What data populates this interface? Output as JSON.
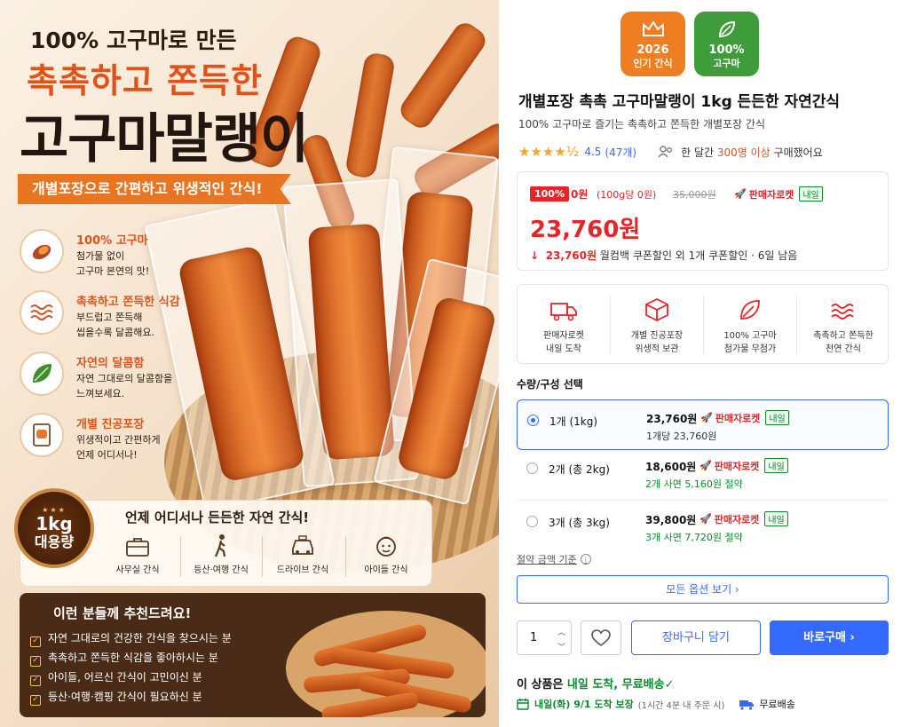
{
  "banner": {
    "headline_small": "100% 고구마로 만든",
    "headline_orange": "촉촉하고 쫀득한",
    "headline_big": "고구마말랭이",
    "ribbon": "개별포장으로 간편하고 위생적인 간식!",
    "features": [
      {
        "icon": "sweet-potato-icon",
        "title": "100% 고구마",
        "desc": "첨가물 없이\n고구마 본연의 맛!"
      },
      {
        "icon": "wave-icon",
        "title": "촉촉하고 쫀득한 식감",
        "desc": "부드럽고 쫀득해\n씹을수록 달콤해요."
      },
      {
        "icon": "leaf-icon",
        "title": "자연의 달콤함",
        "desc": "자연 그대로의 달콤함을\n느껴보세요."
      },
      {
        "icon": "package-icon",
        "title": "개별 진공포장",
        "desc": "위생적이고 간편하게\n언제 어디서나!"
      }
    ],
    "badge": {
      "line1": "1kg",
      "line2": "대용량",
      "stars": "★★★"
    },
    "anytime_title": "언제 어디서나 든든한 자연 간식!",
    "uses": [
      {
        "icon": "briefcase-icon",
        "label": "사무실 간식"
      },
      {
        "icon": "hiker-icon",
        "label": "등산·여행 간식"
      },
      {
        "icon": "car-icon",
        "label": "드라이브 간식"
      },
      {
        "icon": "child-face-icon",
        "label": "아이들 간식"
      }
    ],
    "recommend_title": "이런 분들께 추천드려요!",
    "recommend_items": [
      "자연 그대로의 건강한 간식을 찾으시는 분",
      "촉촉하고 쫀득한 식감을 좋아하시는 분",
      "아이들, 어르신 간식이 고민이신 분",
      "등산·여행·캠핑 간식이 필요하신 분"
    ]
  },
  "product": {
    "badges": [
      {
        "icon": "crown-icon",
        "line1": "2026",
        "line2": "인기 간식",
        "color": "#ef7d22"
      },
      {
        "icon": "leaf-icon",
        "line1": "100%",
        "line2": "고구마",
        "color": "#3f9c3a"
      }
    ],
    "title": "개별포장 촉촉 고구마말랭이 1kg 든든한 자연간식",
    "subtitle": "100% 고구마로 즐기는 촉촉하고 쫀득한 개별포장 간식",
    "stars": "★★★★½",
    "rating": "4.5",
    "review_count": "(47개)",
    "buyers_prefix": "한 달간",
    "buyers_highlight": "300명 이상",
    "buyers_suffix": "구매했어요"
  },
  "price": {
    "discount_tag": "100%",
    "coupon_price": "0원",
    "per_unit": "(100g당 0원)",
    "original_price": "35,000원",
    "rocket_label": "판매자로켓",
    "tomorrow_label": "내일",
    "main_price": "23,760원",
    "coupon_arrow": "↓",
    "coupon_amount": "23,760원",
    "coupon_text": "월컴백 쿠폰할인 외 1개 쿠폰할인 · 6일 남음"
  },
  "benefits": [
    {
      "icon": "truck-icon",
      "label": "판매자로켓\n내일 도착"
    },
    {
      "icon": "box-icon",
      "label": "개별 진공포장\n위생적 보관"
    },
    {
      "icon": "leaf-icon",
      "label": "100% 고구마\n첨가물 무첨가"
    },
    {
      "icon": "wave-icon",
      "label": "촉촉하고 쫀득한\n천연 간식"
    }
  ],
  "options": {
    "title": "수량/구성 선택",
    "items": [
      {
        "name": "1개 (1kg)",
        "price": "23,760원",
        "rocket": "판매자로켓",
        "tomorrow": "내일",
        "sub": "1개당 23,760원",
        "selected": true
      },
      {
        "name": "2개 (총 2kg)",
        "price": "18,600원",
        "rocket": "판매자로켓",
        "tomorrow": "내일",
        "sub": "2개 사면 5,160원 절약",
        "selected": false
      },
      {
        "name": "3개 (총 3kg)",
        "price": "39,800원",
        "rocket": "판매자로켓",
        "tomorrow": "내일",
        "sub": "3개 사면 7,720원 절약",
        "selected": false
      }
    ],
    "save_basis": "절약 금액 기준",
    "all_options": "모든 옵션 보기 ›"
  },
  "purchase": {
    "quantity": "1",
    "cart_label": "장바구니 담기",
    "buy_label": "바로구매 ›"
  },
  "delivery": {
    "prefix": "이 상품은",
    "highlight": "내일 도착, 무료배송",
    "check": "✓",
    "eta_date": "내일(화) 9/1 도착 보장",
    "eta_note": "(1시간 4분 내 주문 시)",
    "free_label": "무료배송"
  },
  "colors": {
    "accent_blue": "#346aff",
    "sale_red": "#e52528",
    "banner_orange": "#e0521a",
    "green": "#0a8a2c"
  }
}
